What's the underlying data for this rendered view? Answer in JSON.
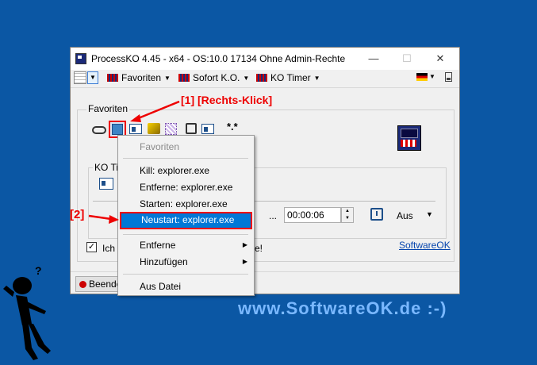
{
  "window": {
    "title": "ProcessKO 4.45 - x64  - OS:10.0 17134 Ohne Admin-Rechte",
    "minimize": "—",
    "maximize": "☐",
    "close": "✕"
  },
  "toolbar": {
    "menus": [
      "Favoriten",
      "Sofort K.O.",
      "KO Timer"
    ]
  },
  "favorites": {
    "group_label": "Favoriten",
    "wildcard": "*.*"
  },
  "ko_timer": {
    "group_label": "KO Ti",
    "dots": "...",
    "time": "00:00:06",
    "mode": "Aus"
  },
  "options": {
    "checkbox_label": "Ich",
    "checkbox_tail": "e!",
    "link": "SoftwareOK"
  },
  "status": {
    "end_label": "Beende"
  },
  "context_menu": {
    "header": "Favoriten",
    "items": [
      "Kill: explorer.exe",
      "Entferne: explorer.exe",
      "Starten: explorer.exe",
      "Neustart: explorer.exe"
    ],
    "submenus": [
      "Entferne",
      "Hinzufügen"
    ],
    "file": "Aus Datei"
  },
  "annotations": {
    "step1": "[1] [Rechts-Klick]",
    "step2": "[2]"
  },
  "website": "www.SoftwareOK.de :-)",
  "colors": {
    "background": "#0b57a4",
    "highlight": "#0078d7",
    "annotation": "#e00000",
    "website": "#7ab8ff"
  }
}
